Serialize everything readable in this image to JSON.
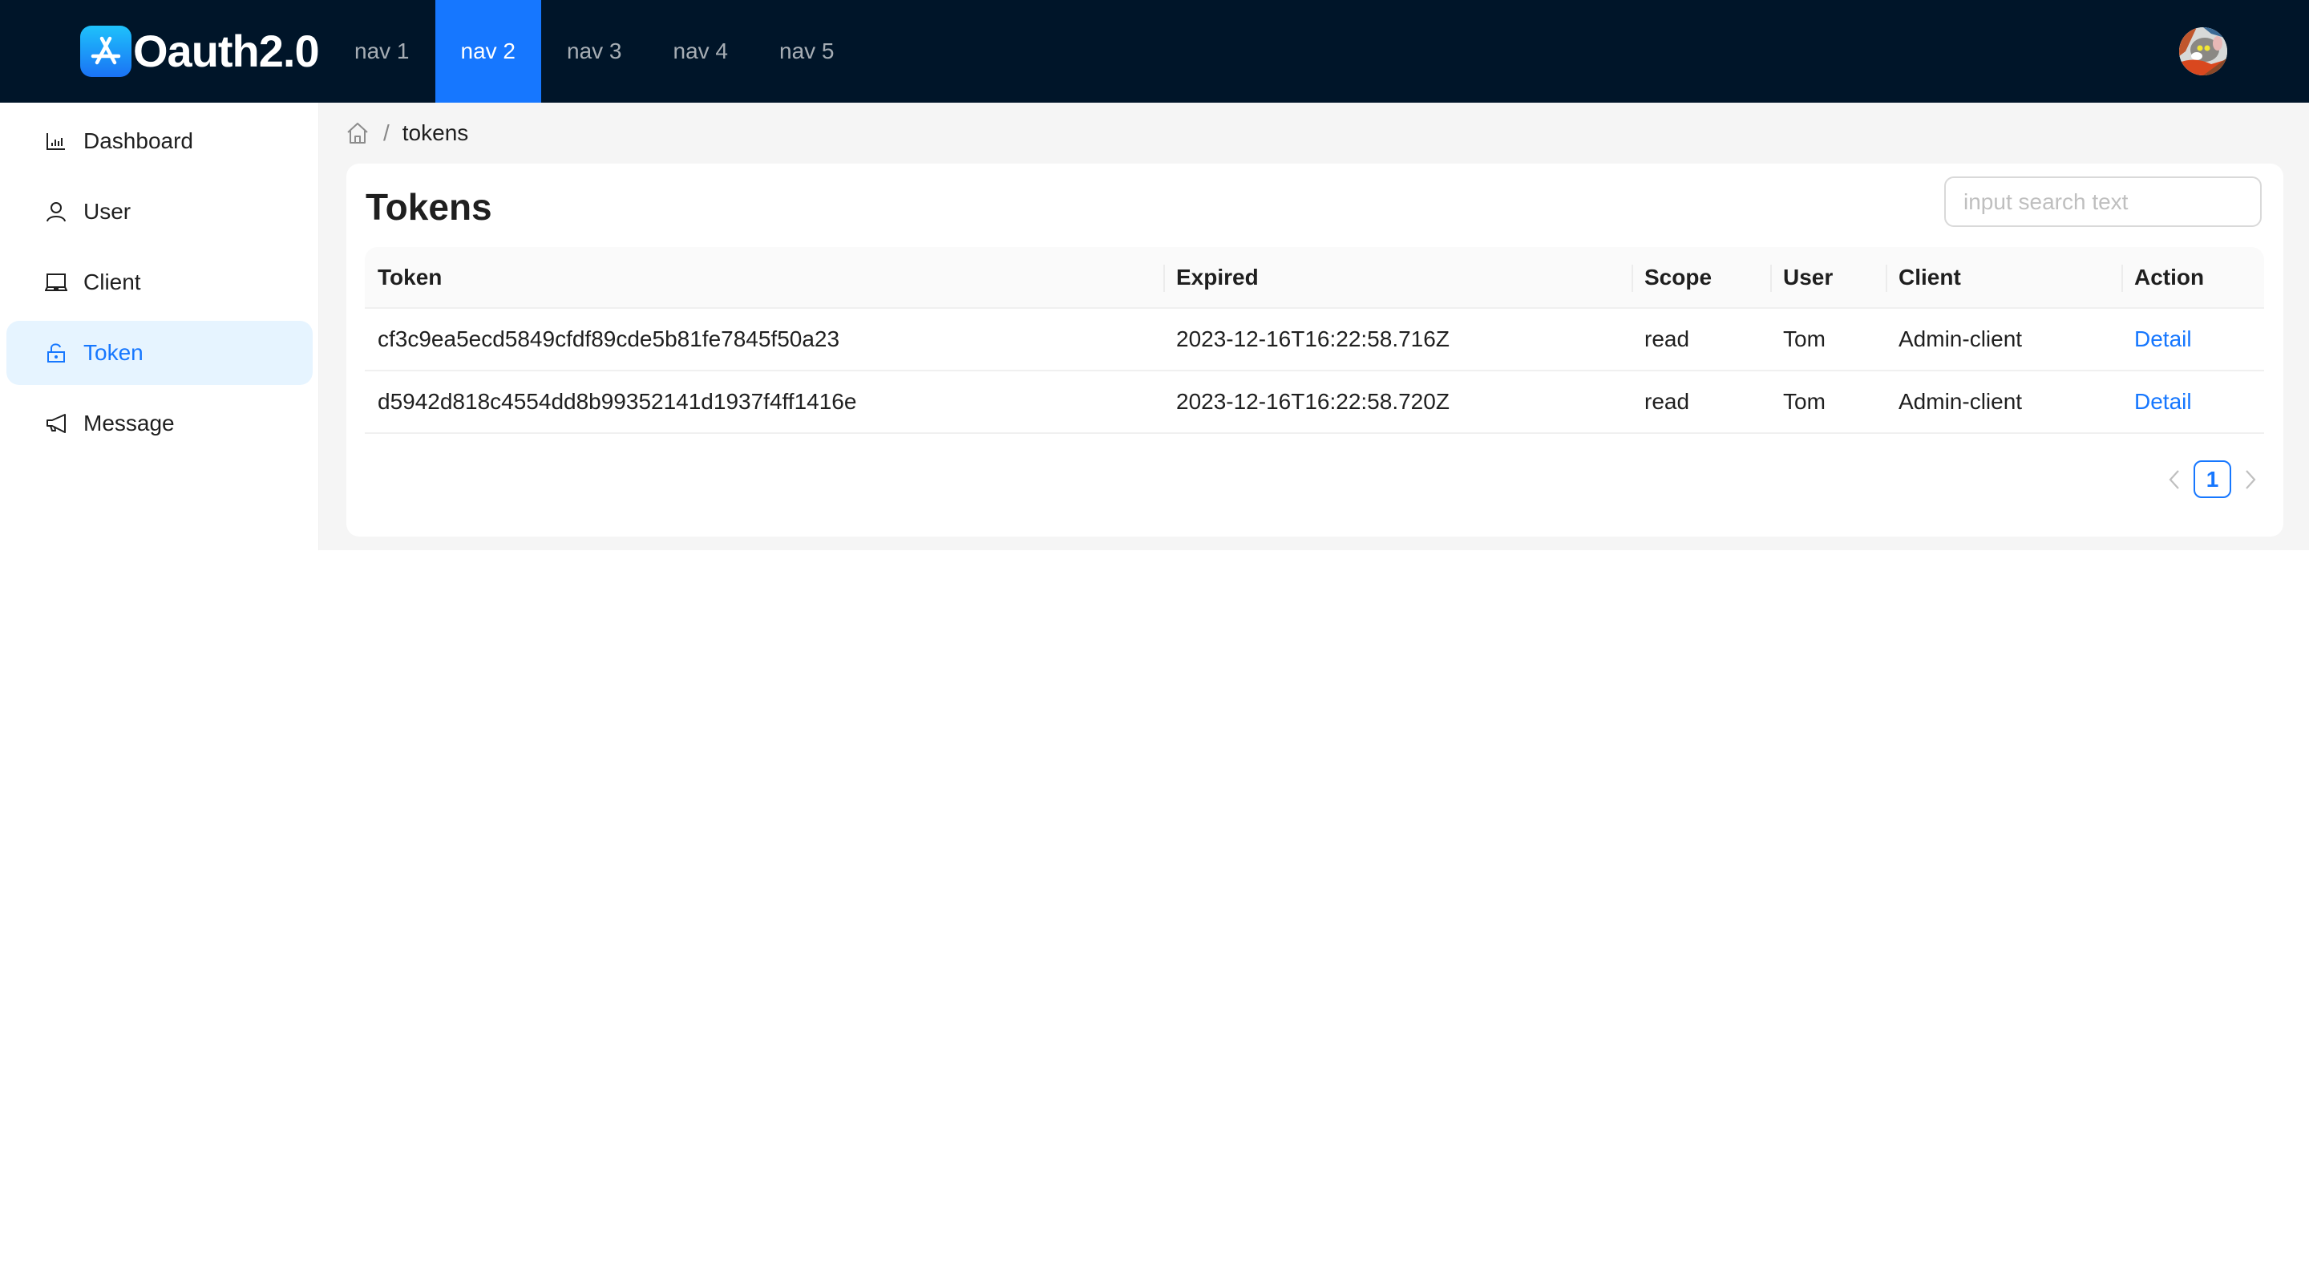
{
  "app": {
    "title": "Oauth2.0",
    "logo_icon": "app-store-a-icon"
  },
  "header": {
    "nav": [
      {
        "label": "nav 1",
        "active": false
      },
      {
        "label": "nav 2",
        "active": true
      },
      {
        "label": "nav 3",
        "active": false
      },
      {
        "label": "nav 4",
        "active": false
      },
      {
        "label": "nav 5",
        "active": false
      }
    ],
    "avatar_icon": "user-avatar"
  },
  "sidebar": {
    "items": [
      {
        "label": "Dashboard",
        "icon": "bar-chart-icon",
        "active": false
      },
      {
        "label": "User",
        "icon": "user-icon",
        "active": false
      },
      {
        "label": "Client",
        "icon": "laptop-icon",
        "active": false
      },
      {
        "label": "Token",
        "icon": "unlock-icon",
        "active": true
      },
      {
        "label": "Message",
        "icon": "megaphone-icon",
        "active": false
      }
    ]
  },
  "breadcrumb": {
    "home_icon": "home-icon",
    "separator": "/",
    "current": "tokens"
  },
  "main": {
    "title": "Tokens",
    "search": {
      "placeholder": "input search text",
      "value": "",
      "icon": "search-icon"
    },
    "table": {
      "columns": [
        "Token",
        "Expired",
        "Scope",
        "User",
        "Client",
        "Action"
      ],
      "rows": [
        {
          "token": "cf3c9ea5ecd5849cfdf89cde5b81fe7845f50a23",
          "expired": "2023-12-16T16:22:58.716Z",
          "scope": "read",
          "user": "Tom",
          "client": "Admin-client",
          "action": "Detail"
        },
        {
          "token": "d5942d818c4554dd8b99352141d1937f4ff1416e",
          "expired": "2023-12-16T16:22:58.720Z",
          "scope": "read",
          "user": "Tom",
          "client": "Admin-client",
          "action": "Detail"
        }
      ]
    },
    "pagination": {
      "prev": "<",
      "current_page": "1",
      "next": ">"
    }
  },
  "colors": {
    "header_bg": "#001529",
    "accent": "#1677ff",
    "selected_bg": "#e6f4ff",
    "content_bg": "#f5f5f5"
  }
}
